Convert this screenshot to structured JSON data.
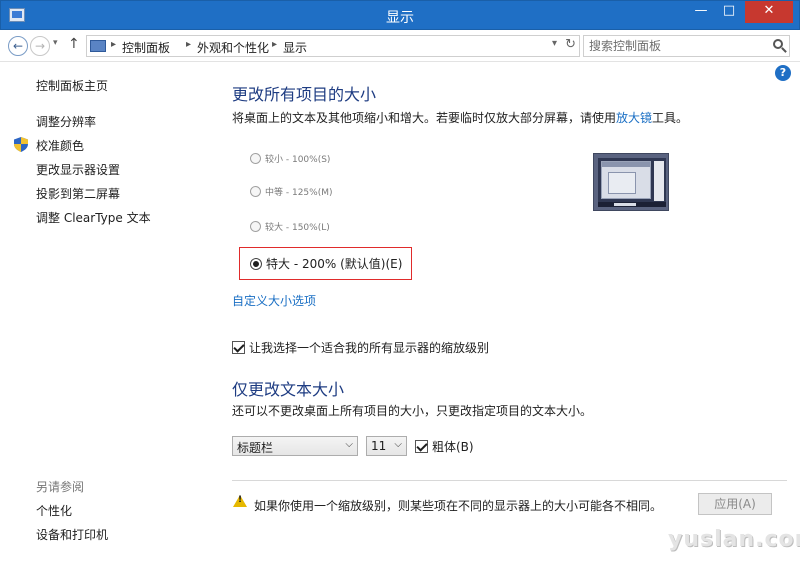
{
  "window": {
    "title": "显示"
  },
  "titlebar_buttons": {
    "minimize": "—",
    "maximize": "□",
    "close": "✕"
  },
  "nav": {
    "back": "←",
    "forward": "→",
    "recent": "▾",
    "up": "↑",
    "breadcrumb": [
      "控制面板",
      "外观和个性化",
      "显示"
    ],
    "breadcrumb_sep": "▸",
    "search_placeholder": "搜索控制面板"
  },
  "help": "?",
  "sidebar": {
    "home": "控制面板主页",
    "items": [
      "调整分辨率",
      "校准颜色",
      "更改显示器设置",
      "投影到第二屏幕",
      "调整 ClearType 文本"
    ],
    "see_also_title": "另请参阅",
    "see_also": [
      "个性化",
      "设备和打印机"
    ]
  },
  "main": {
    "title": "更改所有项目的大小",
    "description_prefix": "将桌面上的文本及其他项缩小和增大。若要临时仅放大部分屏幕，请使用",
    "magnifier_link": "放大镜",
    "description_suffix": "工具。",
    "options": [
      {
        "label": "较小 - 100%(S)",
        "selected": false
      },
      {
        "label": "中等 - 125%(M)",
        "selected": false
      },
      {
        "label": "较大 - 150%(L)",
        "selected": false
      },
      {
        "label": "特大 - 200% (默认值)(E)",
        "selected": true
      }
    ],
    "custom_link": "自定义大小选项",
    "let_me_choose": "让我选择一个适合我的所有显示器的缩放级别",
    "text_title": "仅更改文本大小",
    "text_description": "还可以不更改桌面上所有项目的大小，只更改指定项目的文本大小。",
    "item_select": "标题栏",
    "size_select": "11",
    "bold_label": "粗体(B)",
    "warning": "如果你使用一个缩放级别，则某些项在不同的显示器上的大小可能各不相同。",
    "apply": "应用(A)"
  },
  "watermark": "yuslan.com",
  "colors": {
    "accent": "#1f6fc5",
    "heading": "#1e3c82",
    "link": "#1a6fc4",
    "highlight": "#e02b2b",
    "close": "#c7382f"
  }
}
